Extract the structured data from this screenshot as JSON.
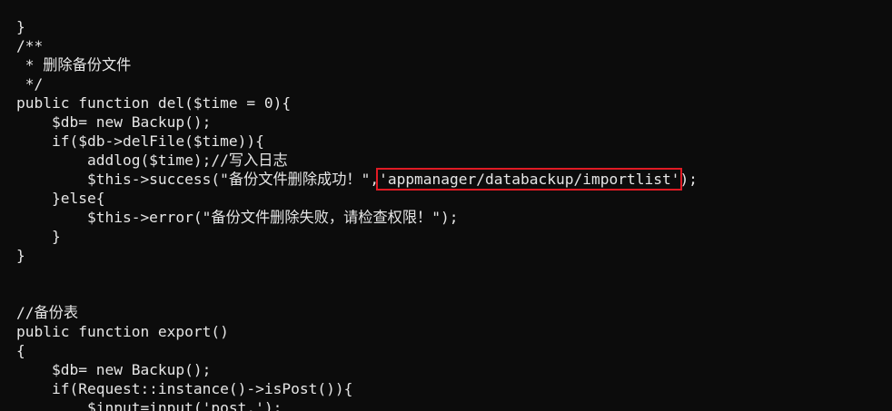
{
  "lines": [
    "}",
    "/**",
    " * 删除备份文件",
    " */",
    "public function del($time = 0){",
    "    $db= new Backup();",
    "    if($db->delFile($time)){",
    "        addlog($time);//写入日志",
    "        $this->success(\"备份文件删除成功！\",",
    "    }else{",
    "        $this->error(\"备份文件删除失败，请检查权限！\");",
    "    }",
    "}",
    "",
    "",
    "//备份表",
    "public function export()",
    "{",
    "    $db= new Backup();",
    "    if(Request::instance()->isPost()){",
    "        $input=input('post.');"
  ],
  "highlight": {
    "text": "'appmanager/databackup/importlist'",
    "suffix": ");",
    "color": "#e01b24"
  },
  "colors": {
    "background": "#0c0c0c",
    "text": "#e6e6e6"
  }
}
